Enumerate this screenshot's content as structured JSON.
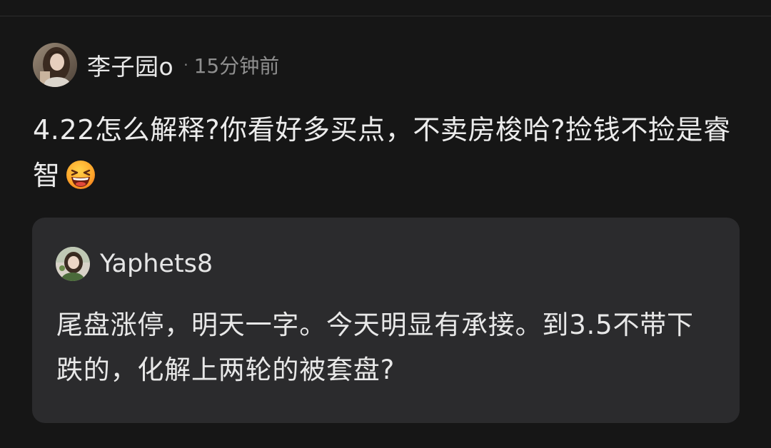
{
  "post": {
    "author": "李子园o",
    "separator": "·",
    "time": "15分钟前",
    "text": "4.22怎么解释?你看好多买点，不卖房梭哈?捡钱不捡是睿智",
    "emoji": "grinning-squinting-face-emoji"
  },
  "quote": {
    "author": "Yaphets8",
    "text": "尾盘涨停，明天一字。今天明显有承接。到3.5不带下跌的，化解上两轮的被套盘?"
  },
  "colors": {
    "background": "#161616",
    "card_background": "#2b2b2d",
    "text_primary": "#ececec",
    "text_muted": "#8f8f8f"
  }
}
